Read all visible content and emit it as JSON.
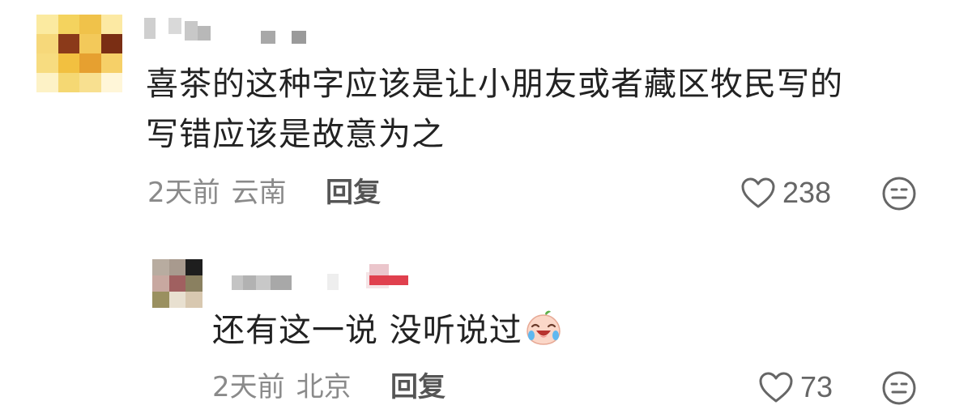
{
  "comments": [
    {
      "text_lines": [
        "喜茶的这种字应该是让小朋友或者藏区牧民写的",
        "写错应该是故意为之"
      ],
      "time": "2天前",
      "location": "云南",
      "reply_label": "回复",
      "likes": "238",
      "avatar_icon": "blurred-avatar",
      "like_icon": "heart-outline-icon",
      "dislike_icon": "neutral-face-icon"
    },
    {
      "text": "还有这一说 没听说过",
      "emoji_icon": "laughing-crying-peach-emoji",
      "time": "2天前",
      "location": "北京",
      "reply_label": "回复",
      "likes": "73",
      "avatar_icon": "blurred-avatar",
      "like_icon": "heart-outline-icon",
      "dislike_icon": "neutral-face-icon"
    }
  ],
  "colors": {
    "text": "#222222",
    "meta": "#8a8a8a",
    "icon": "#666666"
  }
}
